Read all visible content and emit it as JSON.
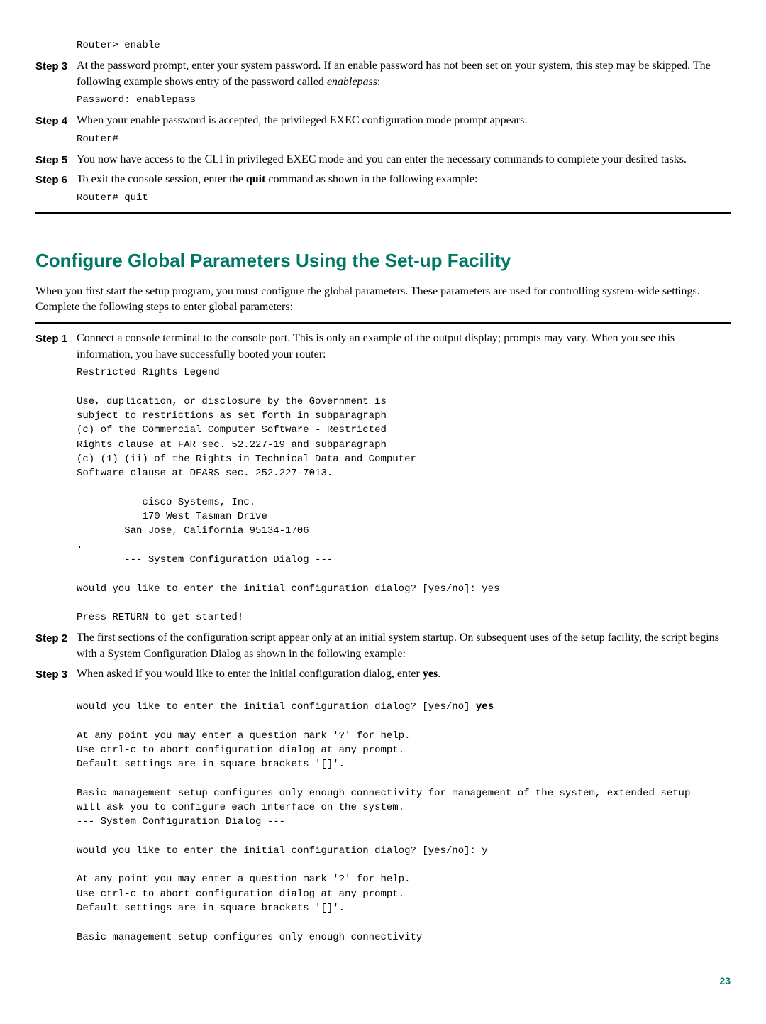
{
  "steps_top": [
    {
      "label": "",
      "pre_code": "Router> enable"
    },
    {
      "label": "Step 3",
      "text1": "At the password prompt, enter your system password. If an enable password has not been set on your system, this step may be skipped. The following example shows entry of the password called ",
      "em1": "enablepass",
      "text2": ":",
      "code": "Password: enablepass"
    },
    {
      "label": "Step 4",
      "text1": "When your enable password is accepted, the privileged EXEC configuration mode prompt appears:",
      "code": "Router#"
    },
    {
      "label": "Step 5",
      "text1": "You now have access to the CLI in privileged EXEC mode and you can enter the necessary commands to complete your desired tasks."
    },
    {
      "label": "Step 6",
      "text1": "To exit the console session, enter the ",
      "bold1": "quit",
      "text2": " command as shown in the following example:",
      "code": "Router# quit"
    }
  ],
  "heading": "Configure Global Parameters Using the Set-up Facility",
  "intro": "When you first start the setup program, you must configure the global parameters. These parameters are used for controlling system-wide settings. Complete the following steps to enter global parameters:",
  "steps_bottom": [
    {
      "label": "Step 1",
      "text1": "Connect a console terminal to the console port. This is only an example of the output display; prompts may vary. When you see this information, you have successfully booted your router:",
      "code": "Restricted Rights Legend\n\nUse, duplication, or disclosure by the Government is\nsubject to restrictions as set forth in subparagraph\n(c) of the Commercial Computer Software - Restricted\nRights clause at FAR sec. 52.227-19 and subparagraph\n(c) (1) (ii) of the Rights in Technical Data and Computer\nSoftware clause at DFARS sec. 252.227-7013.\n\n           cisco Systems, Inc.\n           170 West Tasman Drive\n        San Jose, California 95134-1706\n.\n        --- System Configuration Dialog ---\n\nWould you like to enter the initial configuration dialog? [yes/no]: yes\n\nPress RETURN to get started!"
    },
    {
      "label": "Step 2",
      "text1": "The first sections of the configuration script appear only at an initial system startup. On subsequent uses of the setup facility, the script begins with a System Configuration Dialog as shown in the following example:"
    },
    {
      "label": "Step 3",
      "text1": "When asked if you would like to enter the initial configuration dialog, enter ",
      "bold1": "yes",
      "text2": ".",
      "code_pre": "\nWould you like to enter the initial configuration dialog? [yes/no] ",
      "code_bold": "yes",
      "code_post": "\n\nAt any point you may enter a question mark '?' for help.\nUse ctrl-c to abort configuration dialog at any prompt.\nDefault settings are in square brackets '[]'.\n\nBasic management setup configures only enough connectivity for management of the system, extended setup\nwill ask you to configure each interface on the system.\n--- System Configuration Dialog ---\n\nWould you like to enter the initial configuration dialog? [yes/no]: y\n\nAt any point you may enter a question mark '?' for help.\nUse ctrl-c to abort configuration dialog at any prompt.\nDefault settings are in square brackets '[]'.\n\nBasic management setup configures only enough connectivity"
    }
  ],
  "page_number": "23"
}
